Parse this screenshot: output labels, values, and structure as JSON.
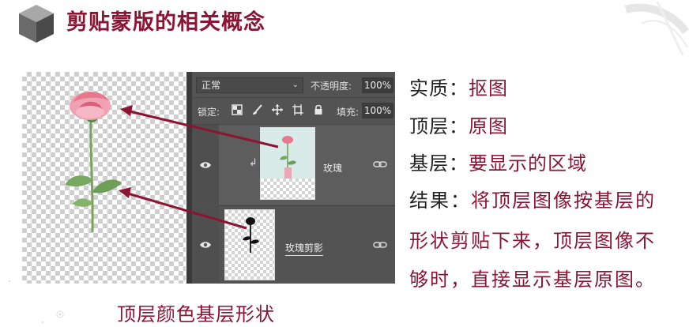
{
  "header": {
    "title": "剪贴蒙版的相关概念"
  },
  "panel": {
    "blend_mode": "正常",
    "opacity_label": "不透明度:",
    "opacity_value": "100%",
    "lock_label": "锁定:",
    "fill_label": "填充:",
    "fill_value": "100%",
    "layers": [
      {
        "name": "玫瑰",
        "clipped": true
      },
      {
        "name": "玫瑰剪影",
        "clipped": false
      }
    ]
  },
  "definitions": [
    {
      "term": "实质：",
      "value": "抠图"
    },
    {
      "term": "顶层：",
      "value": "原图"
    },
    {
      "term": "基层：",
      "value": "要显示的区域"
    }
  ],
  "result": {
    "term": "结果：",
    "lines": [
      "将顶层图像按基层的",
      "形状剪贴下来，顶层图像不",
      "够时，直接显示基层原图。"
    ]
  },
  "caption": "顶层颜色基层形状",
  "colors": {
    "accent": "#8b1533",
    "panel_bg": "#535353"
  },
  "icons": [
    "cube-icon",
    "eye-icon",
    "link-icon",
    "lock-transparency-icon",
    "lock-brush-icon",
    "move-icon",
    "artboard-icon",
    "lock-icon",
    "clip-arrow-icon"
  ]
}
